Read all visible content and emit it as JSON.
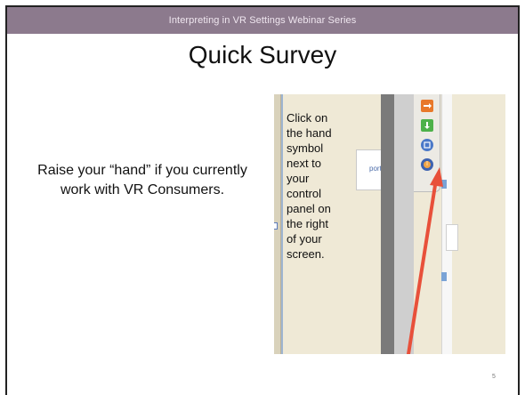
{
  "header": {
    "title": "Interpreting in VR Settings Webinar Series"
  },
  "slide": {
    "title": "Quick Survey",
    "body": "Raise your “hand” if you currently work with VR Consumers.",
    "page_number": "5"
  },
  "screenshot": {
    "instruction_lines": [
      "Click on",
      "the hand",
      "symbol",
      "next to",
      "your",
      "control",
      "panel on",
      "the right",
      "of your",
      "screen."
    ],
    "port_label": "port",
    "toolbar_icons": [
      "exit-icon",
      "download-icon",
      "window-icon",
      "hand-icon"
    ],
    "colors": {
      "arrow": "#e8503a",
      "hand_button": "#3d62b0",
      "header_band": "#8c7a8d"
    }
  }
}
